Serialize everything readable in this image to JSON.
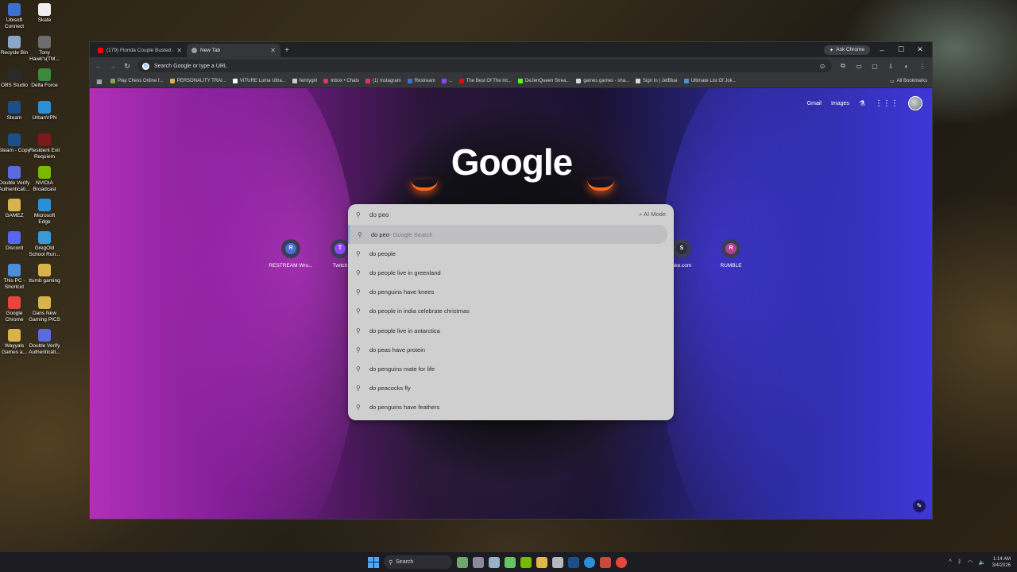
{
  "desktop": {
    "icons": [
      {
        "label": "Ubisoft Connect",
        "color": "#3b6fd1"
      },
      {
        "label": "Skate",
        "color": "#eeeeee"
      },
      {
        "label": "Recycle Bin",
        "color": "#8aa6c8"
      },
      {
        "label": "Tony Hawk's(TM...",
        "color": "#6d6d6d"
      },
      {
        "label": "OBS Studio",
        "color": "#2a2a2a"
      },
      {
        "label": "Delta Force",
        "color": "#3c8a3c"
      },
      {
        "label": "Steam",
        "color": "#1b4f8a"
      },
      {
        "label": "UrbanVPN",
        "color": "#2d8fd8"
      },
      {
        "label": "Steam - Copy",
        "color": "#1b4f8a"
      },
      {
        "label": "Resident Evil Requiem",
        "color": "#7a1a1a"
      },
      {
        "label": "Double Verify Authenticati...",
        "color": "#5a6be0"
      },
      {
        "label": "NVIDIA Broadcast",
        "color": "#76b900"
      },
      {
        "label": "GAMEZ",
        "color": "#d8b24a"
      },
      {
        "label": "Microsoft Edge",
        "color": "#2b8fd6"
      },
      {
        "label": "Discord",
        "color": "#5865f2"
      },
      {
        "label": "GregOld School Run...",
        "color": "#3a9ad8"
      },
      {
        "label": "This PC - Shortcut",
        "color": "#4a8fd8"
      },
      {
        "label": "ttumb gaming",
        "color": "#d8b24a"
      },
      {
        "label": "Google Chrome",
        "color": "#e8453c"
      },
      {
        "label": "Dans New Gaming PICS",
        "color": "#d8b24a"
      },
      {
        "label": "Wayyals Games a...",
        "color": "#d8b24a"
      },
      {
        "label": "Double Verify Authenticati...",
        "color": "#5a6be0"
      }
    ]
  },
  "browser": {
    "tabs": [
      {
        "title": "(179) Florida Couple Busted at...",
        "favicon_color": "#ff0000",
        "close": "✕"
      },
      {
        "title": "New Tab",
        "favicon_color": "#9aa0a6",
        "close": "✕"
      }
    ],
    "new_tab": "+",
    "ask_chrome": "Ask Chrome",
    "window_controls": [
      "–",
      "☐",
      "✕"
    ],
    "omnibox_placeholder": "Search Google or type a URL",
    "bookmarks": [
      {
        "label": "Play Chess Online f...",
        "color": "#7fa650"
      },
      {
        "label": "PERSONALITY TRAI...",
        "color": "#d8b24a"
      },
      {
        "label": "VITURE Luma Ultra...",
        "color": "#ffffff"
      },
      {
        "label": "feintygirl",
        "color": "#cccccc"
      },
      {
        "label": "Inbox • Chats",
        "color": "#e1306c"
      },
      {
        "label": "(1) Instagram",
        "color": "#e1306c"
      },
      {
        "label": "Restream",
        "color": "#3b6fd1"
      },
      {
        "label": "...",
        "color": "#9146ff"
      },
      {
        "label": "The Best Of The Int...",
        "color": "#ff0000"
      },
      {
        "label": "DeJenQueen Strea...",
        "color": "#53fc18"
      },
      {
        "label": "games games - sha...",
        "color": "#d8d8d8"
      },
      {
        "label": "Sign In | JetBlue",
        "color": "#d8d8d8"
      },
      {
        "label": "Ultimate List Of Jok...",
        "color": "#4a8fd8"
      }
    ],
    "all_bookmarks": "All Bookmarks"
  },
  "newtab": {
    "links": {
      "gmail": "Gmail",
      "images": "Images"
    },
    "logo": "Google",
    "search_value": "do peo",
    "ai_mode": "AI Mode",
    "suggestions": [
      {
        "prefix": "do peo",
        "suffix": " - Google Search",
        "highlighted": true
      },
      {
        "prefix": "do peo",
        "suffix": "ple"
      },
      {
        "prefix": "do peo",
        "suffix": "ple live in greenland"
      },
      {
        "prefix": "do pe",
        "suffix": "nguins have knees"
      },
      {
        "prefix": "do peo",
        "suffix": "ple in india celebrate christmas"
      },
      {
        "prefix": "do peo",
        "suffix": "ple live in antarctica"
      },
      {
        "prefix": "do pe",
        "suffix": "as have protein"
      },
      {
        "prefix": "do pe",
        "suffix": "nguins mate for life"
      },
      {
        "prefix": "do pe",
        "suffix": "acocks fly"
      },
      {
        "prefix": "do pe",
        "suffix": "nguins have feathers"
      }
    ],
    "shortcuts": [
      {
        "label": "RESTREAM Wro...",
        "letter": "R",
        "color": "#4a6fd8"
      },
      {
        "label": "Twitch",
        "letter": "T",
        "color": "#9146ff"
      },
      {
        "label": "ake.com",
        "letter": "S",
        "color": "#2b2d3a"
      },
      {
        "label": "RUMBLE",
        "letter": "R",
        "color": "#b8418f"
      }
    ]
  },
  "taskbar": {
    "search_label": "Search",
    "time": "1:14 AM",
    "date": "3/4/2026"
  }
}
